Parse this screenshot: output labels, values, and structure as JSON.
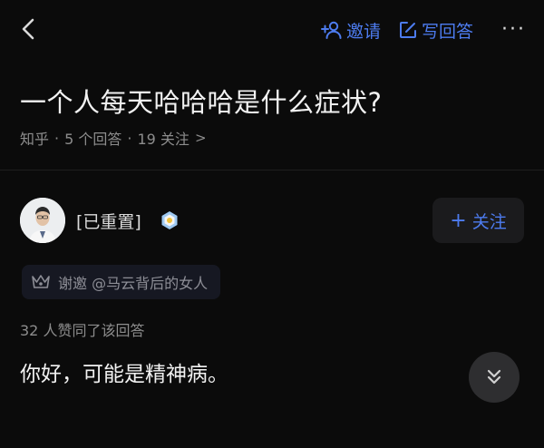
{
  "topbar": {
    "invite_label": "邀请",
    "write_label": "写回答",
    "more_label": "···"
  },
  "question": {
    "title": "一个人每天哈哈哈是什么症状?",
    "source": "知乎",
    "answers": "5 个回答",
    "followers": "19 关注",
    "sep": "·",
    "chevron": ">"
  },
  "author": {
    "name": "[已重置]",
    "follow_label": "关注",
    "follow_plus": "+"
  },
  "invite_tag": {
    "text": "谢邀 @马云背后的女人"
  },
  "answer": {
    "votes": "32 人赞同了该回答",
    "content": "你好，可能是精神病。"
  },
  "colors": {
    "background": "#0b0b0b",
    "accent": "#4d7cf0",
    "muted": "#8d8d8d"
  },
  "icons": {
    "back": "back-icon",
    "invite": "add-user-icon",
    "write": "edit-icon",
    "more": "more-icon",
    "badge": "verified-badge-icon",
    "tag": "crown-icon",
    "scroll": "double-chevron-down-icon"
  }
}
